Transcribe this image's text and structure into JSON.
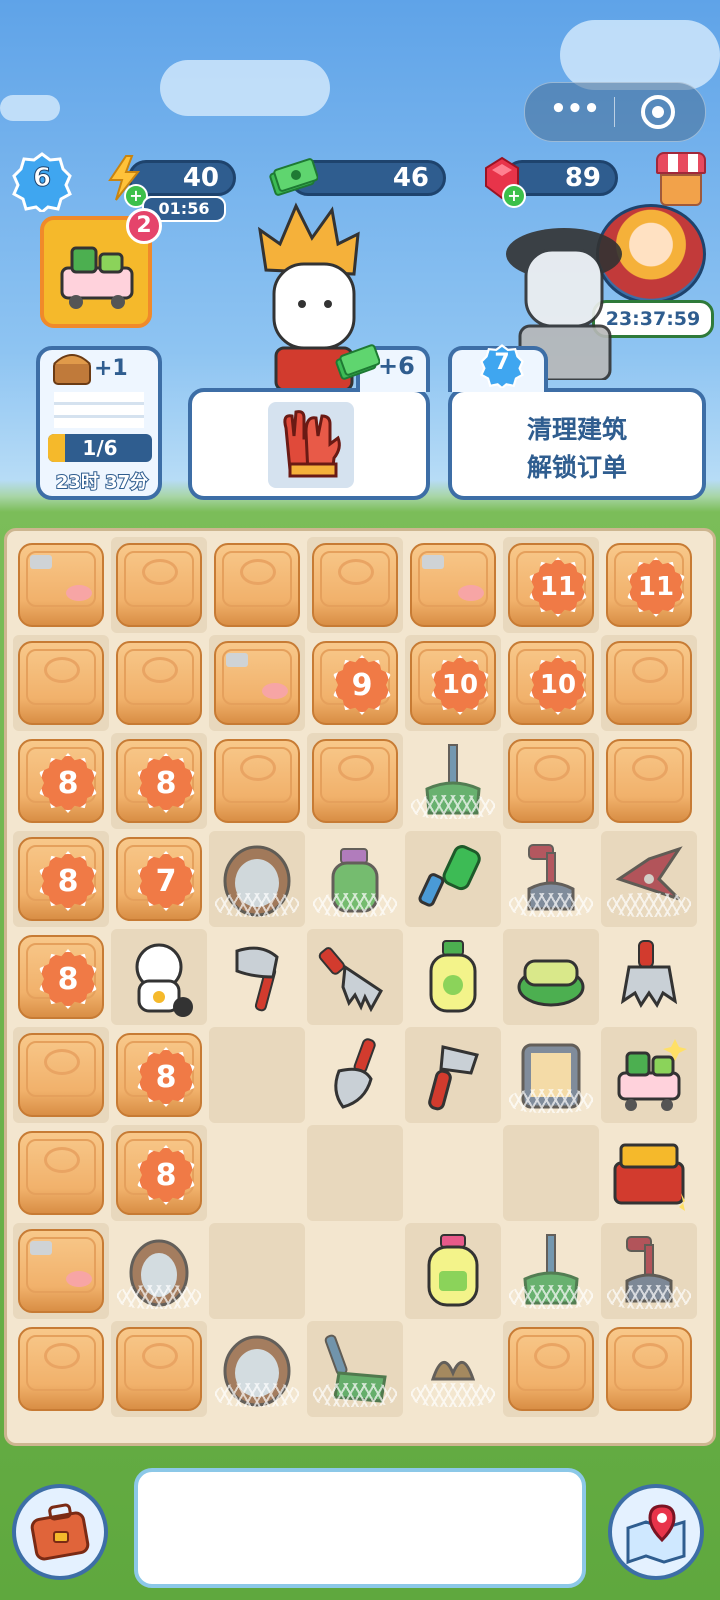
{
  "colors": {
    "accent": "#3d6ea6",
    "board": "#f3e6cf",
    "crate": "#f1b16b",
    "badge": "#f07a46"
  },
  "player": {
    "level": "6"
  },
  "energy": {
    "value": "40",
    "timer": "01:56",
    "icon": "lightning-icon"
  },
  "cash": {
    "value": "46",
    "icon": "cash-icon"
  },
  "gems": {
    "value": "89",
    "icon": "ruby-icon"
  },
  "event": {
    "timer": "23:37:59"
  },
  "cart_bonus": {
    "badge": "2"
  },
  "task_panel": {
    "reward": "+1",
    "progress_text": "1/6",
    "progress": 0.1667,
    "time_left": "23时 37分"
  },
  "order": {
    "reward": "+6",
    "item": "gloves-icon"
  },
  "unlock": {
    "level": "7",
    "line1": "清理建筑",
    "line2": "解锁订单"
  },
  "board": {
    "rows": [
      [
        "crate-tag",
        "crate",
        "crate",
        "crate",
        "crate-tag",
        "11",
        "11"
      ],
      [
        "crate",
        "crate",
        "crate-tag",
        "9",
        "10",
        "10",
        "crate"
      ],
      [
        "8",
        "8",
        "crate",
        "crate",
        "mop-web",
        "crate",
        "crate"
      ],
      [
        "8",
        "7",
        "mirror-web",
        "spray-web",
        "flashlight",
        "plunger-web",
        "clippers-web"
      ],
      [
        "8",
        "lucky-cat",
        "axe",
        "rake",
        "soap",
        "sponge",
        "scraper"
      ],
      [
        "crate",
        "8",
        "empty",
        "trowel",
        "putty-knife",
        "photo-web",
        "cart"
      ],
      [
        "crate",
        "8",
        "empty",
        "empty",
        "empty",
        "empty",
        "toolbox"
      ],
      [
        "crate-tag",
        "frame-web",
        "empty",
        "empty",
        "lotion",
        "mop-web",
        "plunger-web"
      ],
      [
        "crate",
        "crate",
        "mirror-web",
        "shovel-web",
        "bird-web",
        "crate",
        "crate"
      ]
    ]
  }
}
